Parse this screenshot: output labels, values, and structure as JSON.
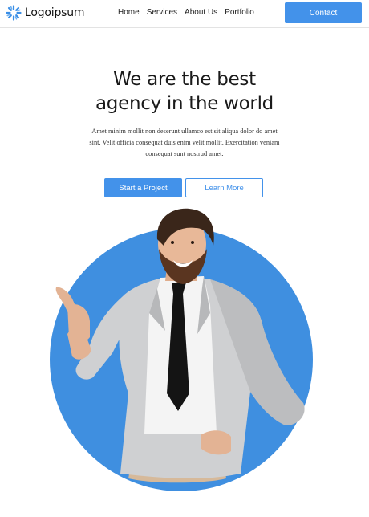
{
  "header": {
    "logo_text": "Logoipsum",
    "nav": [
      "Home",
      "Services",
      "About Us",
      "Portfolio"
    ],
    "contact_label": "Contact"
  },
  "hero": {
    "title_line1": "We are the best",
    "title_line2": "agency in the world",
    "description": "Amet minim mollit non deserunt ullamco est sit aliqua dolor do amet sint. Velit officia consequat duis enim velit mollit. Exercitation veniam consequat sunt nostrud amet.",
    "primary_cta": "Start a Project",
    "secondary_cta": "Learn More"
  },
  "colors": {
    "accent": "#4392ea",
    "circle": "#3f8fe0",
    "text": "#1f1f1f"
  },
  "icons": {
    "logo": "sunburst-logo-icon"
  }
}
